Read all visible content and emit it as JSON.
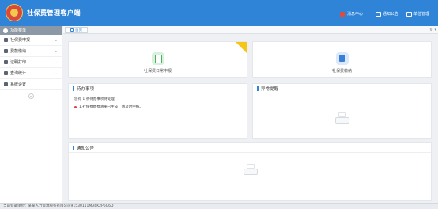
{
  "header": {
    "title": "社保费管理客户端",
    "actions": [
      {
        "label": "消息中心",
        "icon": "bell-icon"
      },
      {
        "label": "通知公告",
        "icon": "notice-icon"
      },
      {
        "label": "单位管理",
        "icon": "unit-icon"
      }
    ]
  },
  "sidebar": {
    "header": "功能菜单",
    "items": [
      {
        "label": "社保费申报",
        "icon": "declare-icon"
      },
      {
        "label": "费款缴纳",
        "icon": "payment-icon"
      },
      {
        "label": "证明打印",
        "icon": "print-icon"
      },
      {
        "label": "查询统计",
        "icon": "query-icon"
      },
      {
        "label": "系统设置",
        "icon": "gear-icon"
      }
    ]
  },
  "tabs": {
    "home": "首页"
  },
  "features": [
    {
      "label": "社保费日常申报",
      "icon": "document-icon",
      "color": "#4caf63"
    },
    {
      "label": "社保费缴纳",
      "icon": "book-icon",
      "color": "#3b7fd6"
    }
  ],
  "todo": {
    "title": "待办事项",
    "summary": "您有 1 条待办事项待处理",
    "items": [
      "1.社保费缴费清册已生成，请及时申报。"
    ]
  },
  "alerts": {
    "title": "异常提醒"
  },
  "notices": {
    "title": "通知公告"
  },
  "status": {
    "text": "当前登录单位：某某人力资源服务有限公司91530111MA6K2P6G6D"
  },
  "colors": {
    "primary": "#2f84d8",
    "badge": "#f5c518",
    "todo_dot": "#e23b3b"
  }
}
